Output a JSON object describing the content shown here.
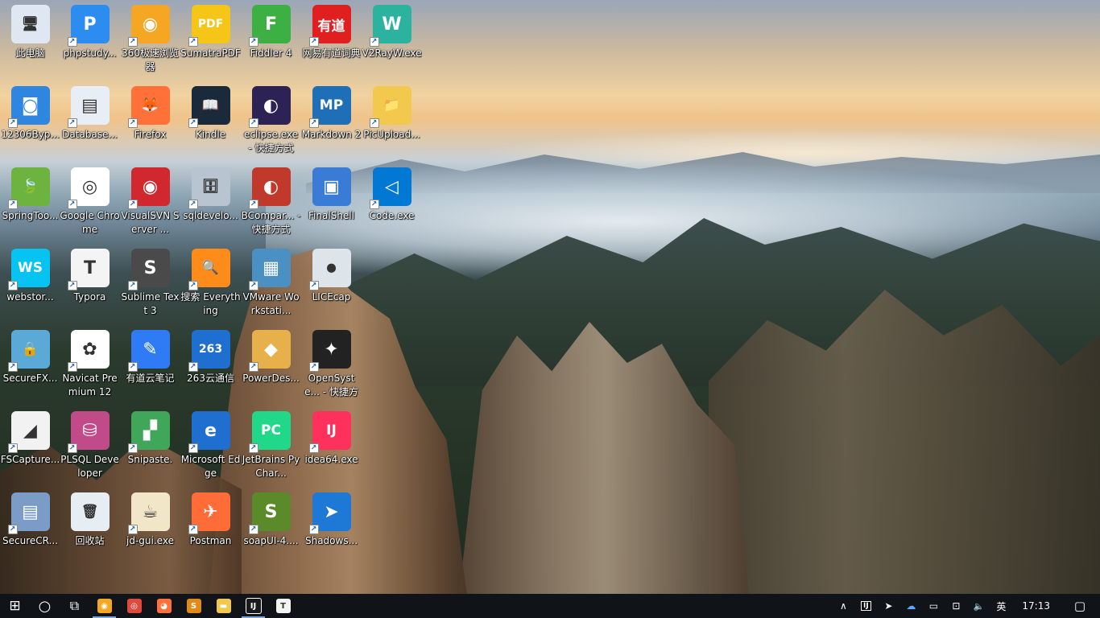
{
  "desktop": {
    "icons": [
      {
        "label": "此电脑",
        "icon": "computer-icon",
        "color": "#dfe8f2",
        "glyph": "🖥",
        "shortcut": false
      },
      {
        "label": "phpstudy...",
        "icon": "phpstudy-icon",
        "color": "#2d8cf0",
        "glyph": "P",
        "shortcut": true
      },
      {
        "label": "360极速浏览器",
        "icon": "360-browser-icon",
        "color": "#f5a623",
        "glyph": "◉",
        "shortcut": true
      },
      {
        "label": "SumatraPDF",
        "icon": "sumatrapdf-icon",
        "color": "#f5c518",
        "glyph": "PDF",
        "shortcut": true
      },
      {
        "label": "Fiddler 4",
        "icon": "fiddler-icon",
        "color": "#3cb043",
        "glyph": "F",
        "shortcut": true
      },
      {
        "label": "网易有道词典",
        "icon": "youdao-dict-icon",
        "color": "#e02020",
        "glyph": "有道",
        "shortcut": true
      },
      {
        "label": "V2RayW.exe",
        "icon": "v2rayw-icon",
        "color": "#2bb3a0",
        "glyph": "W",
        "shortcut": true
      },
      {
        "label": "12306Byp...",
        "icon": "12306-icon",
        "color": "#2f86e0",
        "glyph": "◙",
        "shortcut": true
      },
      {
        "label": "Database...",
        "icon": "database-icon",
        "color": "#e8eef5",
        "glyph": "▤",
        "shortcut": true
      },
      {
        "label": "Firefox",
        "icon": "firefox-icon",
        "color": "#ff7139",
        "glyph": "🦊",
        "shortcut": true
      },
      {
        "label": "Kindle",
        "icon": "kindle-icon",
        "color": "#1a2a3a",
        "glyph": "📖",
        "shortcut": true
      },
      {
        "label": "eclipse.exe - 快捷方式",
        "icon": "eclipse-icon",
        "color": "#2c2255",
        "glyph": "◐",
        "shortcut": true
      },
      {
        "label": "Markdown 2",
        "icon": "markdownpad-icon",
        "color": "#1e6fb8",
        "glyph": "MP",
        "shortcut": true
      },
      {
        "label": "PicUpload...",
        "icon": "folder-icon",
        "color": "#f2c94c",
        "glyph": "📁",
        "shortcut": true
      },
      {
        "label": "SpringToo...",
        "icon": "springtool-icon",
        "color": "#6db33f",
        "glyph": "🍃",
        "shortcut": true
      },
      {
        "label": "Google Chrome",
        "icon": "chrome-icon",
        "color": "#ffffff",
        "glyph": "◎",
        "shortcut": true
      },
      {
        "label": "VisualSVN Server ...",
        "icon": "visualsvn-icon",
        "color": "#d0282e",
        "glyph": "◉",
        "shortcut": true
      },
      {
        "label": "sqldevelo...",
        "icon": "sqldeveloper-icon",
        "color": "#b8c4d0",
        "glyph": "🗄",
        "shortcut": true
      },
      {
        "label": "BCompar... - 快捷方式",
        "icon": "beyondcompare-icon",
        "color": "#c0392b",
        "glyph": "◐",
        "shortcut": true
      },
      {
        "label": "FinalShell",
        "icon": "finalshell-icon",
        "color": "#3a7bd5",
        "glyph": "▣",
        "shortcut": false
      },
      {
        "label": "Code.exe",
        "icon": "vscode-icon",
        "color": "#0078d4",
        "glyph": "◁",
        "shortcut": true
      },
      {
        "label": "webstor...",
        "icon": "webstorm-icon",
        "color": "#07c3f2",
        "glyph": "WS",
        "shortcut": true
      },
      {
        "label": "Typora",
        "icon": "typora-icon",
        "color": "#f4f4f4",
        "glyph": "T",
        "shortcut": true
      },
      {
        "label": "Sublime Text 3",
        "icon": "sublime-icon",
        "color": "#4a4a4a",
        "glyph": "S",
        "shortcut": true
      },
      {
        "label": "搜索 Everything",
        "icon": "everything-icon",
        "color": "#ff8c1a",
        "glyph": "🔍",
        "shortcut": true
      },
      {
        "label": "VMware Workstati...",
        "icon": "vmware-icon",
        "color": "#4a90c2",
        "glyph": "▦",
        "shortcut": true
      },
      {
        "label": "LICEcap",
        "icon": "licecap-icon",
        "color": "#dde4ea",
        "glyph": "⏺",
        "shortcut": true
      },
      {
        "label": "SecureFX...",
        "icon": "securefx-icon",
        "color": "#5aa9d6",
        "glyph": "🔒",
        "shortcut": true
      },
      {
        "label": "Navicat Premium 12",
        "icon": "navicat-icon",
        "color": "#ffffff",
        "glyph": "✿",
        "shortcut": true
      },
      {
        "label": "有道云笔记",
        "icon": "youdao-note-icon",
        "color": "#2f7bf5",
        "glyph": "✎",
        "shortcut": true
      },
      {
        "label": "263云通信",
        "icon": "263-icon",
        "color": "#1f6fd1",
        "glyph": "263",
        "shortcut": true
      },
      {
        "label": "PowerDes...",
        "icon": "powerdesigner-icon",
        "color": "#e8b04a",
        "glyph": "◆",
        "shortcut": true
      },
      {
        "label": "OpenSyste... - 快捷方式",
        "icon": "opensystem-icon",
        "color": "#222222",
        "glyph": "✦",
        "shortcut": true
      },
      {
        "label": "FSCapture...",
        "icon": "fscapture-icon",
        "color": "#f2f2f2",
        "glyph": "◢",
        "shortcut": true
      },
      {
        "label": "PLSQL Developer",
        "icon": "plsql-icon",
        "color": "#c04a8a",
        "glyph": "⛁",
        "shortcut": true
      },
      {
        "label": "Snipaste.",
        "icon": "snipaste-icon",
        "color": "#3fa65a",
        "glyph": "▞",
        "shortcut": true
      },
      {
        "label": "Microsoft Edge",
        "icon": "edge-icon",
        "color": "#1f6fd1",
        "glyph": "e",
        "shortcut": true
      },
      {
        "label": "JetBrains PyChar...",
        "icon": "pycharm-icon",
        "color": "#21d789",
        "glyph": "PC",
        "shortcut": true
      },
      {
        "label": "idea64.exe",
        "icon": "intellij-icon",
        "color": "#fe315d",
        "glyph": "IJ",
        "shortcut": true
      },
      {
        "label": "SecureCR...",
        "icon": "securecrt-icon",
        "color": "#7a9cc6",
        "glyph": "▤",
        "shortcut": true
      },
      {
        "label": "回收站",
        "icon": "recycle-bin-icon",
        "color": "#e6edf3",
        "glyph": "🗑",
        "shortcut": false
      },
      {
        "label": "jd-gui.exe",
        "icon": "jdgui-icon",
        "color": "#f2e6c8",
        "glyph": "☕",
        "shortcut": true
      },
      {
        "label": "Postman",
        "icon": "postman-icon",
        "color": "#ff6c37",
        "glyph": "✈",
        "shortcut": true
      },
      {
        "label": "soapUI-4....",
        "icon": "soapui-icon",
        "color": "#5a8a2a",
        "glyph": "S",
        "shortcut": true
      },
      {
        "label": "Shadows...",
        "icon": "shadowsocks-icon",
        "color": "#1e78d6",
        "glyph": "➤",
        "shortcut": true
      }
    ]
  },
  "taskbar": {
    "start_glyph": "⊞",
    "search_glyph": "○",
    "taskview_glyph": "⧉",
    "pinned": [
      {
        "icon": "360-browser-icon",
        "color": "#f5a623",
        "glyph": "◉",
        "active": true
      },
      {
        "icon": "chrome-icon",
        "color": "#e04a3a",
        "glyph": "◎",
        "active": false
      },
      {
        "icon": "firefox-icon",
        "color": "#ff7139",
        "glyph": "◕",
        "active": false
      },
      {
        "icon": "sublime-icon",
        "color": "#e08a1a",
        "glyph": "S",
        "active": false
      },
      {
        "icon": "file-explorer-icon",
        "color": "#f2c94c",
        "glyph": "▬",
        "active": false
      },
      {
        "icon": "intellij-icon",
        "color": "#1a1a1a",
        "glyph": "IJ",
        "active": true
      },
      {
        "icon": "typora-icon",
        "color": "#f4f4f4",
        "glyph": "T",
        "active": false
      }
    ],
    "tray": {
      "chevron_glyph": "∧",
      "ij_glyph": "IJ",
      "send_glyph": "➤",
      "cloud_glyph": "☁",
      "battery_glyph": "▭",
      "network_glyph": "⊡",
      "volume_glyph": "🔈",
      "ime_label": "英",
      "time": "17:13",
      "notification_glyph": "▢"
    }
  }
}
